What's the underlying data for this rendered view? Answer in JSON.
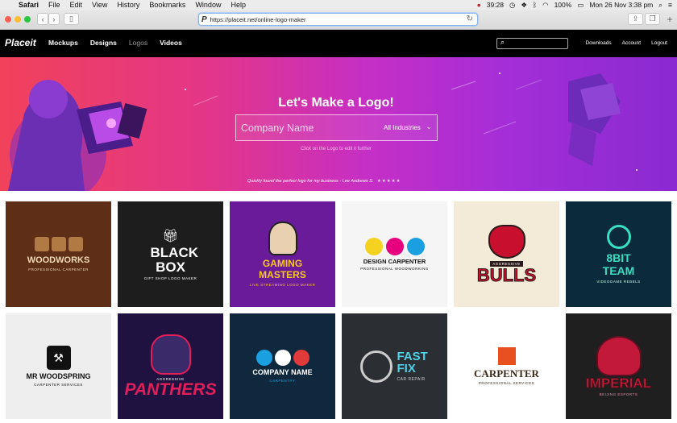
{
  "menubar": {
    "app": "Safari",
    "items": [
      "File",
      "Edit",
      "View",
      "History",
      "Bookmarks",
      "Window",
      "Help"
    ],
    "time": "39:28",
    "battery": "100%",
    "datetime": "Mon 26 Nov  3:38 pm"
  },
  "browser": {
    "url": "https://placeit.net/online-logo-maker",
    "favicon": "P"
  },
  "nav": {
    "logo": "Placeit",
    "links": [
      "Mockups",
      "Designs",
      "Logos",
      "Videos"
    ],
    "right": [
      "Downloads",
      "Account",
      "Logout"
    ]
  },
  "hero": {
    "title": "Let's Make a Logo!",
    "placeholder": "Company Name",
    "industry": "All Industries",
    "hint": "Click on the Logo to edit it further",
    "quote": "Quickly found the perfect logo for my business - Lee Andrews S.",
    "stars": "★★★★★"
  },
  "logos": [
    {
      "name": "WOODWORKS",
      "sub": "PROFESSIONAL CARPENTER",
      "bg": "#5e2e16",
      "fg": "#f0d9b5"
    },
    {
      "name": "BLACK BOX",
      "sub": "GIFT SHOP LOGO MAKER",
      "bg": "#1d1d1d",
      "fg": "#ffffff"
    },
    {
      "name": "GAMING MASTERS",
      "sub": "LIVE STREAMING LOGO MAKER",
      "bg": "#6a1b9a",
      "fg": "#f7c623"
    },
    {
      "name": "DESIGN CARPENTER",
      "sub": "PROFESSIONAL WOODWORKING",
      "bg": "#f5f5f5",
      "fg": "#111111"
    },
    {
      "name": "BULLS",
      "sub": "AGGRESSIVE",
      "bg": "#f3ead7",
      "fg": "#c8102e"
    },
    {
      "name": "8BIT TEAM",
      "sub": "VIDEOGAME REBELS",
      "bg": "#0b2a3b",
      "fg": "#38e0c2"
    },
    {
      "name": "MR WOODSPRING",
      "sub": "CARPENTER SERVICES",
      "bg": "#eeeeee",
      "fg": "#111111"
    },
    {
      "name": "PANTHERS",
      "sub": "AGGRESSIVE",
      "bg": "#1f1240",
      "fg": "#e01e5a"
    },
    {
      "name": "COMPANY NAME",
      "sub": "CARPENTRY",
      "bg": "#10283d",
      "fg": "#ffffff"
    },
    {
      "name": "FAST FIX",
      "sub": "CAR REPAIR",
      "bg": "#2b2f33",
      "fg": "#4fd1e8"
    },
    {
      "name": "CARPENTER",
      "sub": "PROFESSIONAL SERVICES",
      "bg": "#ffffff",
      "fg": "#3a2a1a"
    },
    {
      "name": "IMPERIAL",
      "sub": "BEIJING ESPORTS",
      "bg": "#1f1f1f",
      "fg": "#d61f3a"
    }
  ]
}
